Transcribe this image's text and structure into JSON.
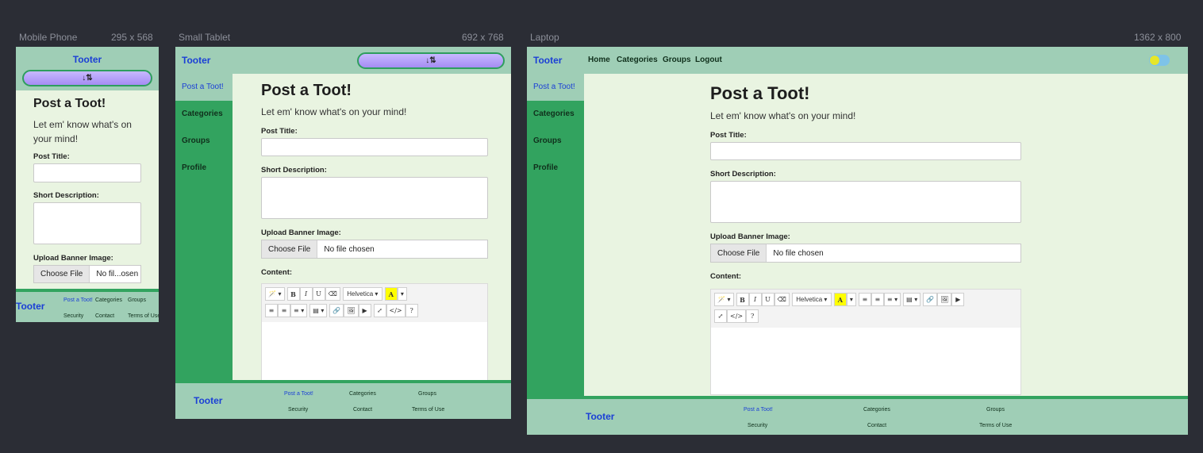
{
  "devices": {
    "mobile": {
      "name": "Mobile Phone",
      "size": "295 x 568"
    },
    "tablet": {
      "name": "Small Tablet",
      "size": "692 x 768"
    },
    "laptop": {
      "name": "Laptop",
      "size": "1362 x 800"
    }
  },
  "brand": "Tooter",
  "sort_icon": "sort-icon",
  "sort_glyph": "↓⇅",
  "nav": {
    "home": "Home",
    "categories": "Categories",
    "groups": "Groups",
    "logout": "Logout"
  },
  "sidebar": [
    "Post a Toot!",
    "Categories",
    "Groups",
    "Profile"
  ],
  "form": {
    "title": "Post a Toot!",
    "subtitle": "Let em' know what's on your mind!",
    "post_title_label": "Post Title:",
    "short_desc_label": "Short Description:",
    "banner_label": "Upload Banner Image:",
    "choose_file": "Choose File",
    "no_file": "No file chosen",
    "no_file_short": "No fil...osen",
    "content_label": "Content:"
  },
  "editor": {
    "font": "Helvetica ▾",
    "buttons": [
      "🪄 ▾",
      "B",
      "I",
      "U",
      "⌫",
      "A",
      "▾",
      "≡",
      "≡",
      "≡ ▾",
      "▤ ▾",
      "🔗",
      "🖼",
      "▶",
      "⤢",
      "</>",
      "?"
    ]
  },
  "footer": {
    "links": [
      "Post a Toot!",
      "Categories",
      "Groups",
      "Security",
      "Contact",
      "Terms of Use"
    ]
  },
  "colors": {
    "accent": "#32a35f",
    "header": "#9fceb6",
    "bg": "#e9f4e1",
    "brand": "#1b3fd6",
    "page": "#2b2d35"
  }
}
